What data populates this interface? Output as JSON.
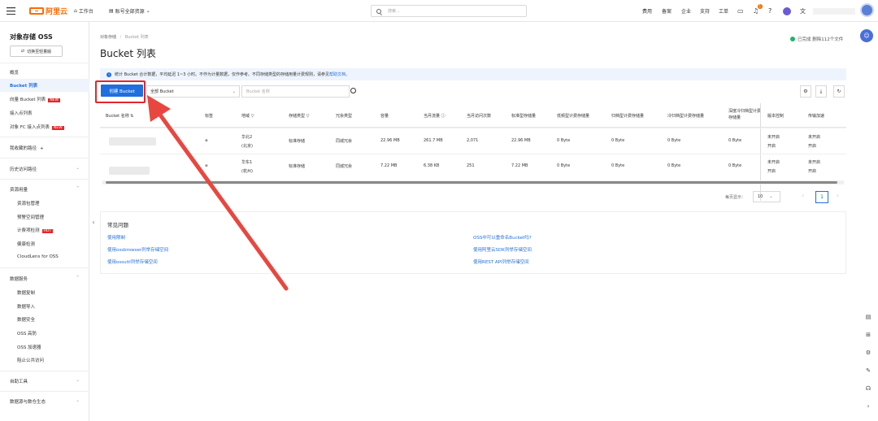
{
  "topbar": {
    "logo": "阿里云",
    "workbench": "工作台",
    "resource_scope": "账号全部资源",
    "search_placeholder": "搜索...",
    "links": [
      "费用",
      "备案",
      "企业",
      "支持",
      "工单"
    ],
    "notification_count": "1"
  },
  "sidebar": {
    "title": "对象存储 OSS",
    "switch_label": "切换至轻量版",
    "items": [
      "概览",
      "Bucket 列表",
      "向量 Bucket 列表",
      "接入点列表",
      "对象 FC 接入点列表"
    ],
    "new_tag": "NEW",
    "hot_tag": "HOT",
    "favorites": "我收藏的路径",
    "history": "历史访问路径",
    "resource_usage": "资源用量",
    "resource_sub": [
      "资源包管理",
      "预警空间管理",
      "计费项检测",
      "健康检测",
      "CloudLens for OSS"
    ],
    "data_services": "数据服务",
    "data_sub": [
      "数据复制",
      "数据导入",
      "数据安全",
      "OSS 高防",
      "OSS 加速器",
      "阻止公共访问"
    ],
    "auto_tools": "自助工具",
    "cut_item": "数据源与数仓生态"
  },
  "breadcrumb": [
    "对象存储",
    "Bucket 列表"
  ],
  "page_title": "Bucket 列表",
  "top_notice": "已完成 删除112个文件",
  "info_text": "统计 Bucket 合计数据，平均延迟 1~3 小时。不作为计量数据，仅作参考。不同存储类型的存储用量计费规则，请参见",
  "info_link": "帮助文档。",
  "toolbar": {
    "create_label": "创建 Bucket",
    "filter_value": "全部 Bucket",
    "search_placeholder": "Bucket 名称"
  },
  "table": {
    "headers": [
      "Bucket 名称",
      "标签",
      "地域",
      "存储类型",
      "冗余类型",
      "容量",
      "当月流量",
      "当月访问次数",
      "标准型存储量",
      "低频型计费存储量",
      "归档型计费存储量",
      "冷归档型计费存储量",
      "深度冷归档型计费存储量",
      "版本控制",
      "传输加速"
    ],
    "rows": [
      {
        "region_top": "华北2",
        "region_bottom": "(北京)",
        "storage": "标准存储",
        "redundancy": "同城冗余",
        "capacity": "22.96 MB",
        "traffic": "261.7 MB",
        "visits": "2,071",
        "standard": "22.96 MB",
        "ia": "0 Byte",
        "archive": "0 Byte",
        "cold": "0 Byte",
        "deep": "0 Byte",
        "versioning": "未开启",
        "versioning_link": "开启",
        "accel": "未开启",
        "accel_link": "开启"
      },
      {
        "region_top": "华东1",
        "region_bottom": "(杭州)",
        "storage": "标准存储",
        "redundancy": "同城冗余",
        "capacity": "7.22 MB",
        "traffic": "6.38 KB",
        "visits": "251",
        "standard": "7.22 MB",
        "ia": "0 Byte",
        "archive": "0 Byte",
        "cold": "0 Byte",
        "deep": "0 Byte",
        "versioning": "未开启",
        "versioning_link": "开启",
        "accel": "未开启",
        "accel_link": "开启"
      }
    ]
  },
  "pagination": {
    "label": "每页显示：",
    "size": "10",
    "current": "1"
  },
  "faq": {
    "title": "常见问题",
    "links": [
      "使用限制",
      "使用ossbrowser列举存储空间",
      "使用ossutil列举存储空间",
      "OSS中可以重命名Bucket吗?",
      "使用阿里云SDK列举存储空间",
      "使用REST API列举存储空间"
    ]
  }
}
